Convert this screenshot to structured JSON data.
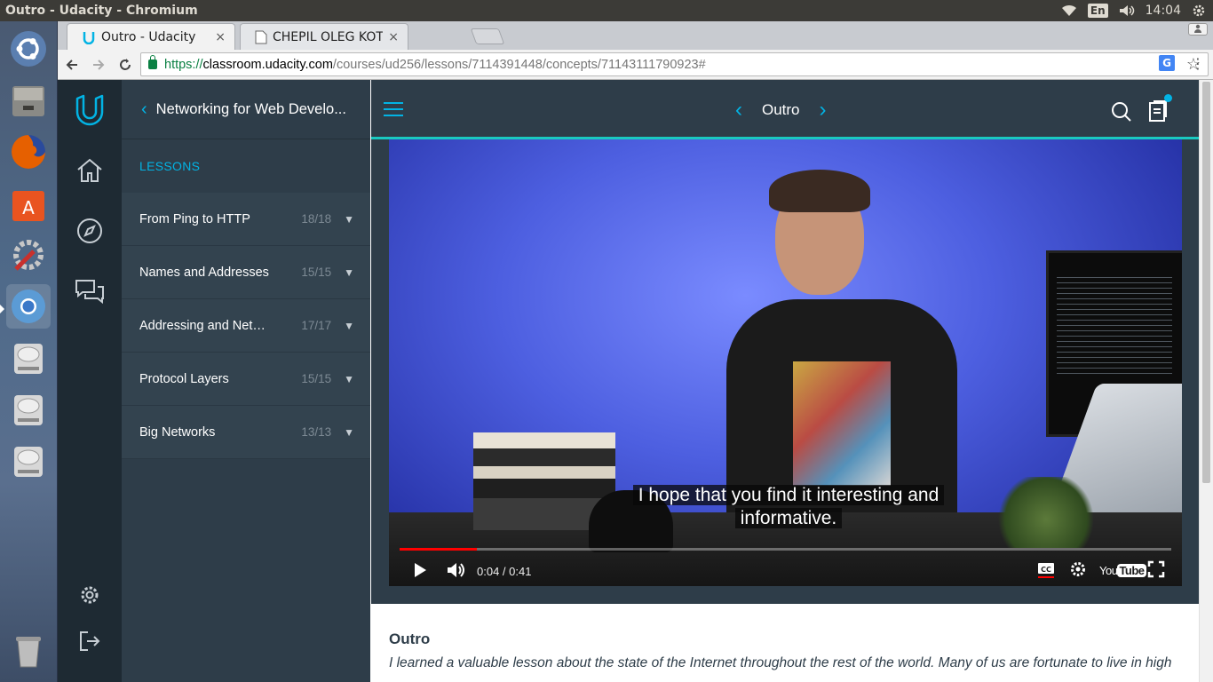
{
  "os": {
    "window_title": "Outro - Udacity - Chromium",
    "lang": "En",
    "clock": "14:04"
  },
  "launcher": {
    "items": [
      "ubuntu-dash-icon",
      "files-icon",
      "firefox-icon",
      "software-center-icon",
      "system-settings-icon",
      "chromium-icon",
      "drive-icon",
      "drive-icon",
      "drive-icon",
      "trash-icon"
    ]
  },
  "browser": {
    "tabs": [
      {
        "title": "Outro - Udacity",
        "close": "×",
        "active": true
      },
      {
        "title": "CHEPIL OLEG KOT…",
        "close": "×",
        "active": false
      }
    ],
    "url": {
      "scheme": "https://",
      "host": "classroom.udacity.com",
      "path": "/courses/ud256/lessons/7114391448/concepts/71143111790923#"
    }
  },
  "sidebar": {
    "course_title": "Networking for Web Develo...",
    "lessons_label": "LESSONS",
    "lessons": [
      {
        "name": "From Ping to HTTP",
        "count": "18/18"
      },
      {
        "name": "Names and Addresses",
        "count": "15/15"
      },
      {
        "name": "Addressing and Netwo...",
        "count": "17/17"
      },
      {
        "name": "Protocol Layers",
        "count": "15/15"
      },
      {
        "name": "Big Networks",
        "count": "13/13"
      }
    ]
  },
  "content": {
    "concept_title": "Outro",
    "video": {
      "caption_line1": "I hope that you find it interesting and",
      "caption_line2": "informative.",
      "time": "0:04 / 0:41",
      "progress": 0.1,
      "brand": "You",
      "brand_tube": "Tube"
    },
    "notes_title": "Outro",
    "notes_body": "I learned a valuable lesson about the state of the Internet throughout the rest of the world. Many of us are fortunate to live in high"
  },
  "colors": {
    "udacity_blue": "#02b3e4",
    "panel_dark": "#2e3d49",
    "rail_dark": "#1e2a33",
    "accent_line": "#1ac9c0"
  }
}
